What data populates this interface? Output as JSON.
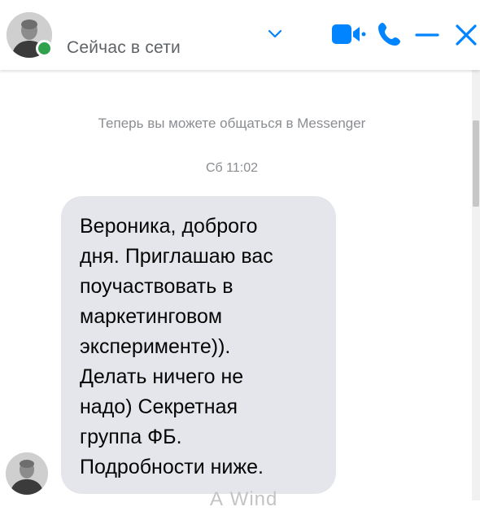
{
  "header": {
    "status": "Сейчас в сети",
    "icons": {
      "avatar": "contact-avatar",
      "online": "online-indicator",
      "dropdown": "chevron-down-icon",
      "video": "video-camera-icon",
      "phone": "phone-icon",
      "minimize": "minimize-icon",
      "close": "close-icon"
    },
    "accent_color": "#0084ff",
    "online_color": "#31a24c"
  },
  "conversation": {
    "notice": "Теперь вы можете общаться в Messenger",
    "timestamp": "Сб 11:02",
    "messages": [
      {
        "direction": "incoming",
        "text": "Вероника, доброго\nдня. Приглашаю вас\nпоучаствовать в\nмаркетинговом\nэксперименте)).\nДелать ничего не\nнадо) Секретная\nгруппа ФБ.\nПодробности ниже."
      }
    ]
  },
  "watermark_fragment": "А         Wind"
}
